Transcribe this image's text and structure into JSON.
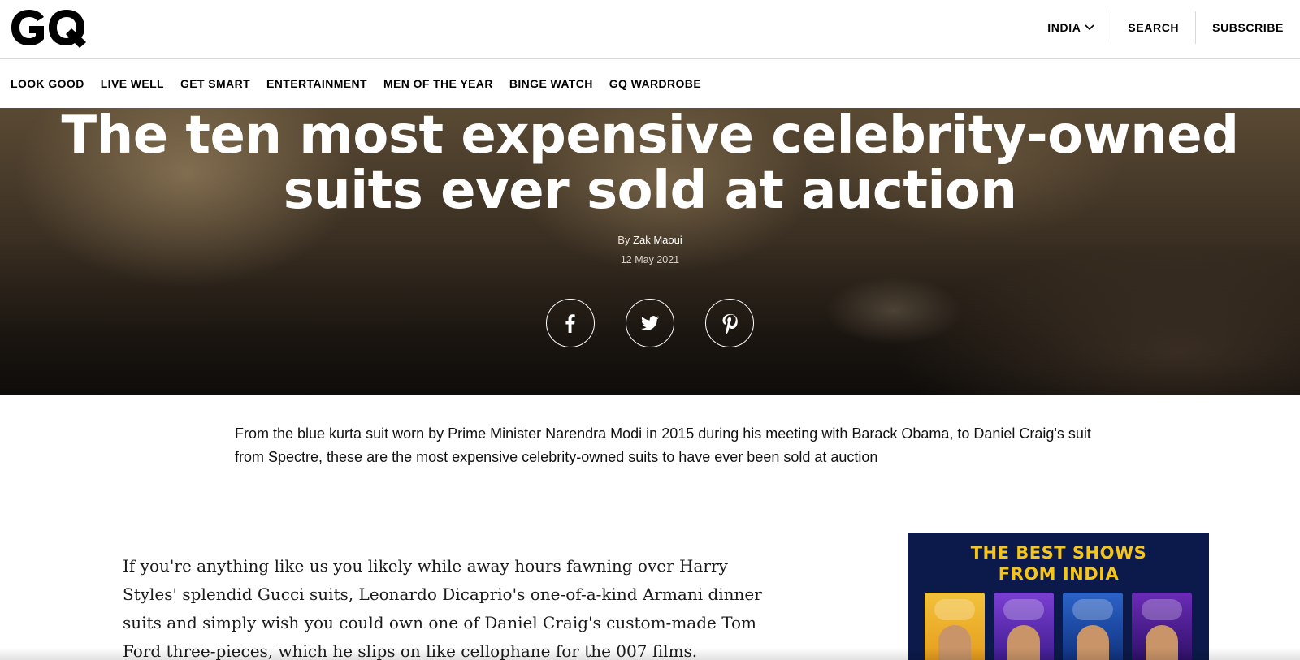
{
  "header": {
    "logo_text": "GQ",
    "edition": "INDIA",
    "search": "SEARCH",
    "subscribe": "SUBSCRIBE"
  },
  "nav": {
    "items": [
      {
        "label": "LOOK GOOD"
      },
      {
        "label": "LIVE WELL"
      },
      {
        "label": "GET SMART"
      },
      {
        "label": "ENTERTAINMENT"
      },
      {
        "label": "MEN OF THE YEAR"
      },
      {
        "label": "BINGE WATCH"
      },
      {
        "label": "GQ WARDROBE"
      }
    ]
  },
  "article": {
    "title_line1": "The ten most expensive celebrity-owned",
    "title_line2": "suits ever sold at auction",
    "by_prefix": "By",
    "author": "Zak Maoui",
    "date": "12 May 2021",
    "share": [
      "facebook-icon",
      "twitter-icon",
      "pinterest-icon"
    ],
    "dek": "From the blue kurta suit worn by Prime Minister Narendra Modi in 2015 during his meeting with Barack Obama, to Daniel Craig's suit from Spectre, these are the most expensive celebrity-owned suits to have ever been sold at auction",
    "body": "If you're anything like us you likely while away hours fawning over Harry Styles' splendid Gucci suits, Leonardo Dicaprio's one-of-a-kind Armani dinner suits and simply wish you could own one of Daniel Craig's custom-made Tom Ford three-pieces, which he slips on like cellophane for the 007 films."
  },
  "ad": {
    "title_line1": "THE BEST SHOWS",
    "title_line2": "FROM INDIA"
  },
  "colors": {
    "ad_background": "#0b1a4a",
    "ad_title": "#f5c518"
  }
}
